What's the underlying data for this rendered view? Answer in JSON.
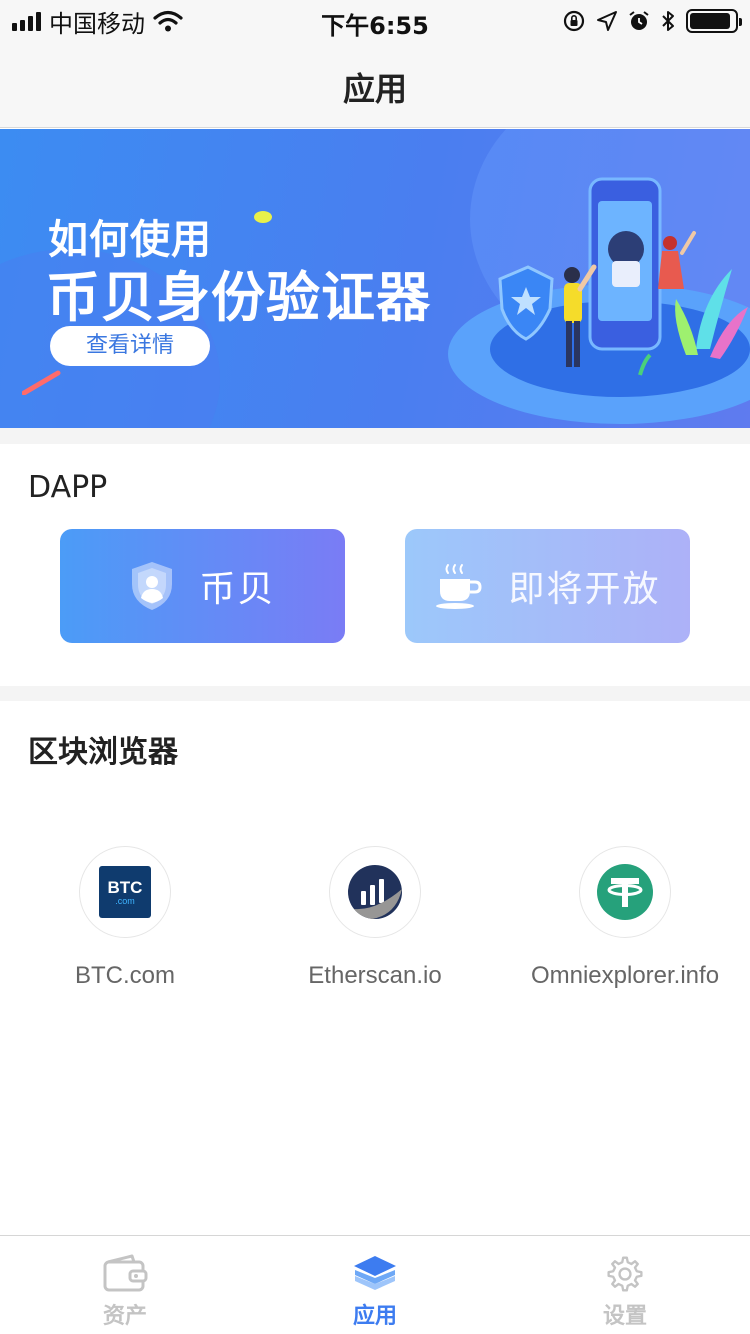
{
  "status_bar": {
    "carrier": "中国移动",
    "time": "下午6:55",
    "icons": [
      "signal-icon",
      "wifi-icon",
      "rotation-lock-icon",
      "location-icon",
      "alarm-icon",
      "bluetooth-icon",
      "battery-icon"
    ],
    "battery_level": 0.92
  },
  "nav": {
    "title": "应用"
  },
  "banner": {
    "line1": "如何使用",
    "line2": "币贝身份验证器",
    "button_label": "查看详情"
  },
  "dapp": {
    "section_title": "DAPP",
    "cards": [
      {
        "label": "币贝",
        "icon": "shield-user-icon"
      },
      {
        "label": "即将开放",
        "icon": "coffee-cup-icon"
      }
    ]
  },
  "explorers": {
    "section_title": "区块浏览器",
    "items": [
      {
        "name": "BTC.com",
        "icon": "btc-com-logo-icon",
        "logo_text": "BTC",
        "logo_subtext": ".com"
      },
      {
        "name": "Etherscan.io",
        "icon": "etherscan-logo-icon"
      },
      {
        "name": "Omniexplorer.info",
        "icon": "tether-logo-icon"
      }
    ]
  },
  "tab_bar": {
    "tabs": [
      {
        "label": "资产",
        "icon": "wallet-icon",
        "active": false
      },
      {
        "label": "应用",
        "icon": "layers-icon",
        "active": true
      },
      {
        "label": "设置",
        "icon": "gear-icon",
        "active": false
      }
    ]
  },
  "colors": {
    "accent": "#3d7cf0",
    "tab_inactive": "#c4c4c4",
    "banner_blue": "#4a7ef0",
    "card1_start": "#4b9cf7",
    "card1_end": "#7a7cf5",
    "tether_green": "#26a17b",
    "btc_navy": "#0f3b6e"
  }
}
